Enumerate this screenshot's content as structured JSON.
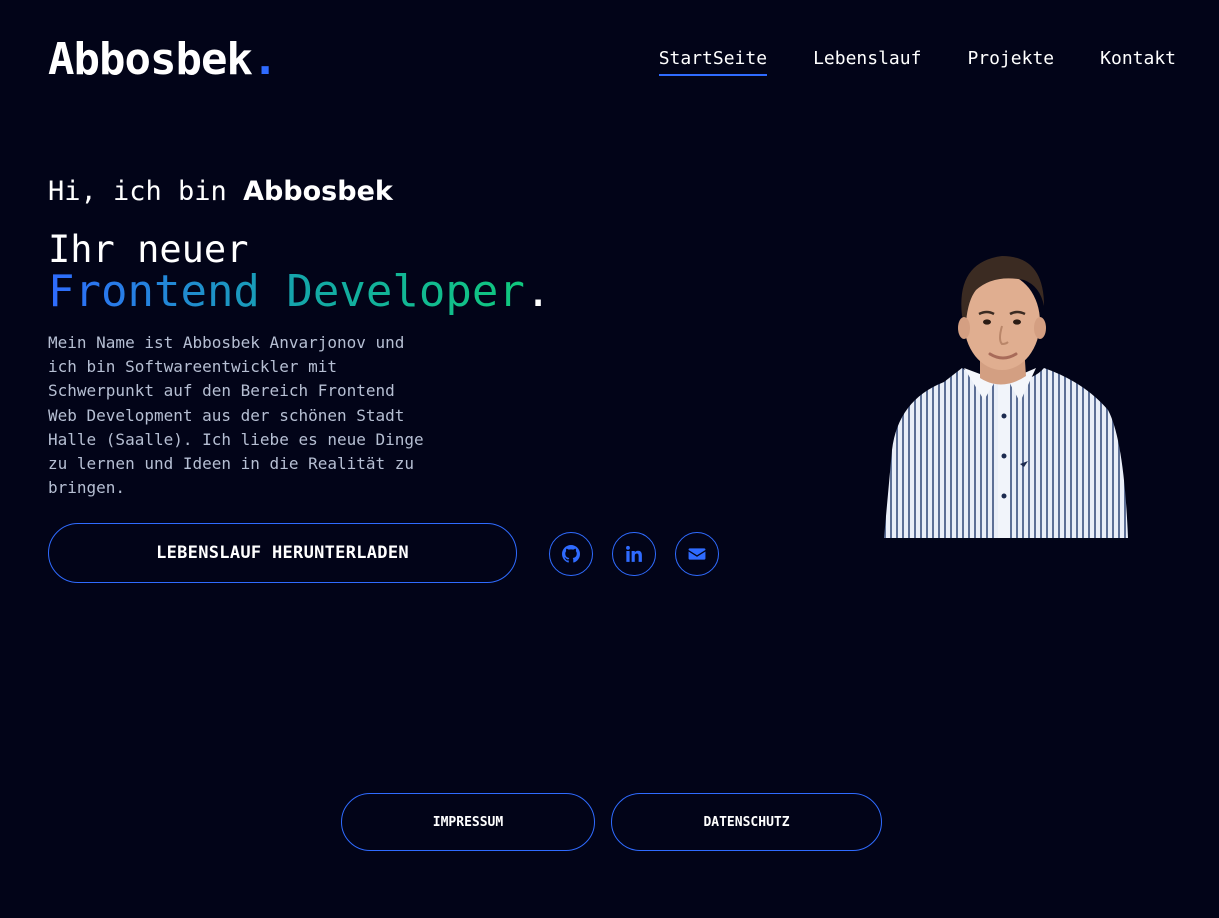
{
  "brand": {
    "name": "Abbosbek",
    "dot": "."
  },
  "nav": {
    "items": [
      {
        "label": "StartSeite",
        "active": true
      },
      {
        "label": "Lebenslauf",
        "active": false
      },
      {
        "label": "Projekte",
        "active": false
      },
      {
        "label": "Kontakt",
        "active": false
      }
    ]
  },
  "hero": {
    "greeting_prefix": "Hi, ich bin ",
    "greeting_name": "Abbosbek",
    "headline_line1": "Ihr neuer",
    "headline_line2": "Frontend Developer",
    "headline_period": ".",
    "intro": "Mein Name ist Abbosbek Anvarjonov und ich bin Softwareentwickler mit Schwerpunkt auf den Bereich Frontend Web Development aus der schönen Stadt Halle (Saalle). Ich liebe es neue Dinge zu lernen und Ideen in die Realität zu bringen.",
    "cv_button": "LEBENSLAUF HERUNTERLADEN",
    "socials": [
      {
        "icon": "github-icon"
      },
      {
        "icon": "linkedin-icon"
      },
      {
        "icon": "mail-icon"
      }
    ]
  },
  "footer": {
    "impressum": "IMPRESSUM",
    "datenschutz": "DATENSCHUTZ"
  },
  "colors": {
    "accent": "#2f6bff",
    "background": "#020418",
    "gradient_end": "#10c97d"
  }
}
